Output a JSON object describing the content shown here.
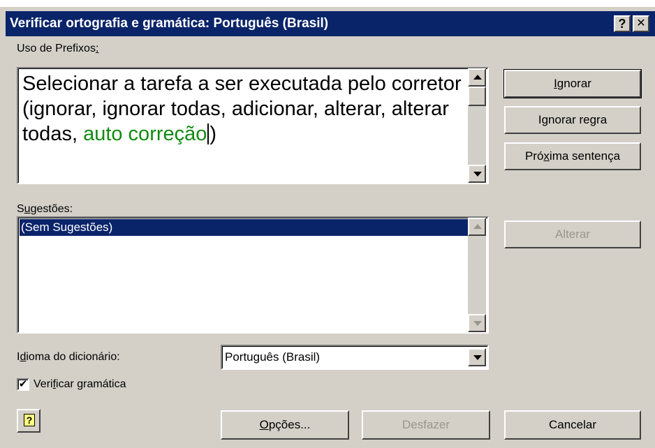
{
  "window": {
    "title": "Verificar ortografia e gramática: Português (Brasil)",
    "help_button": "?",
    "close_button": "✕"
  },
  "sentence_section": {
    "label_prefix": "Uso de Prefixos",
    "label_accel": ":",
    "text_before": "Selecionar a tarefa a ser executada pelo corretor (ignorar, ignorar todas, adicionar, alterar, alterar todas, ",
    "text_highlight": "auto correção",
    "text_after": ")"
  },
  "suggestions_section": {
    "label_a": "S",
    "label_accel": "u",
    "label_b": "gestões:",
    "items": [
      "(Sem Sugestões)"
    ],
    "selected_index": 0
  },
  "buttons": {
    "ignore": {
      "accel": "I",
      "rest": "gnorar"
    },
    "ignore_rule": {
      "a": "I",
      "accel": "g",
      "b": "norar regra"
    },
    "next_sentence": {
      "a": "Pró",
      "accel": "x",
      "b": "ima sentença"
    },
    "change": "Alterar",
    "options": {
      "accel": "O",
      "rest": "pções..."
    },
    "undo": "Desfazer",
    "cancel": "Cancelar"
  },
  "dictionary": {
    "label_a": "I",
    "label_accel": "d",
    "label_b": "ioma do dicionário:",
    "selected": "Português (Brasil)"
  },
  "grammar_check": {
    "label_a": "Veri",
    "label_accel": "f",
    "label_b": "icar gramática",
    "checked": true,
    "check_glyph": "✔"
  },
  "help_icon_glyph": "?",
  "colors": {
    "titlebar": "#0a246a",
    "dialog_face": "#d4d0c8",
    "highlight_text": "#128a12",
    "selection": "#0a246a"
  }
}
